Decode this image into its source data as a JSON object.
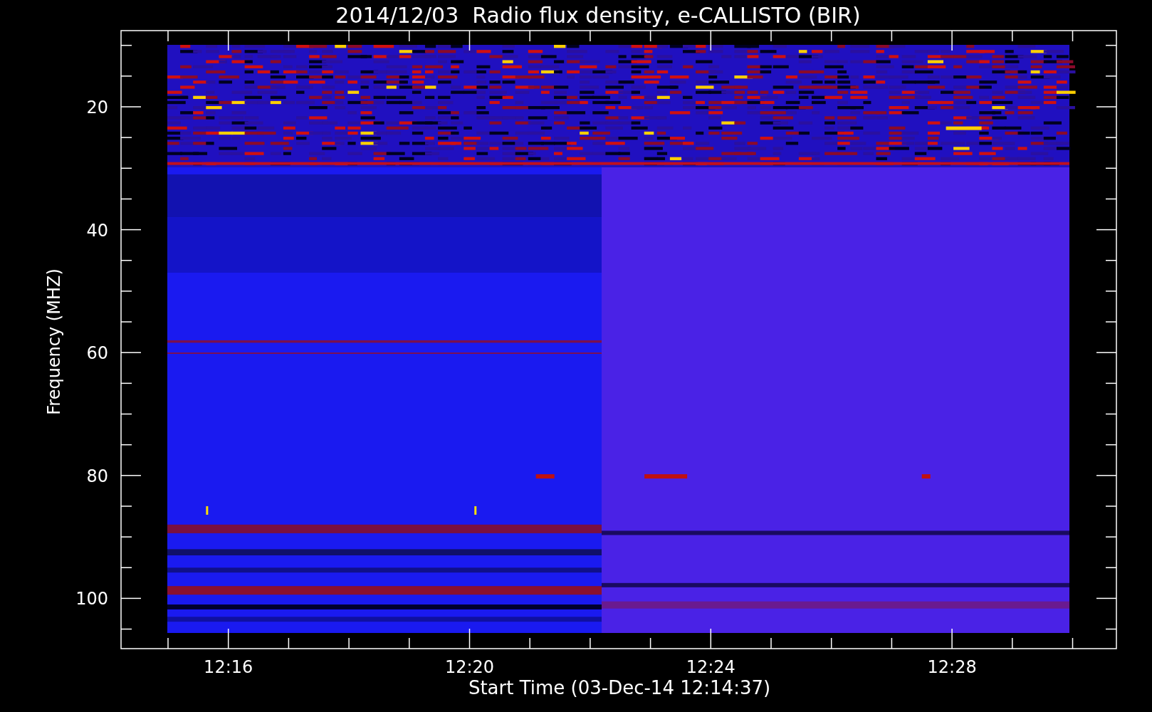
{
  "plot": {
    "title": "2014/12/03  Radio flux density, e-CALLISTO (BIR)",
    "y_axis": {
      "label": "Frequency (MHZ)",
      "ticks": [
        "20",
        "40",
        "60",
        "80",
        "100"
      ]
    },
    "x_axis": {
      "label": "Start Time (03-Dec-14 12:14:37)",
      "ticks": [
        "12:16",
        "12:20",
        "12:24",
        "12:28"
      ]
    }
  }
}
